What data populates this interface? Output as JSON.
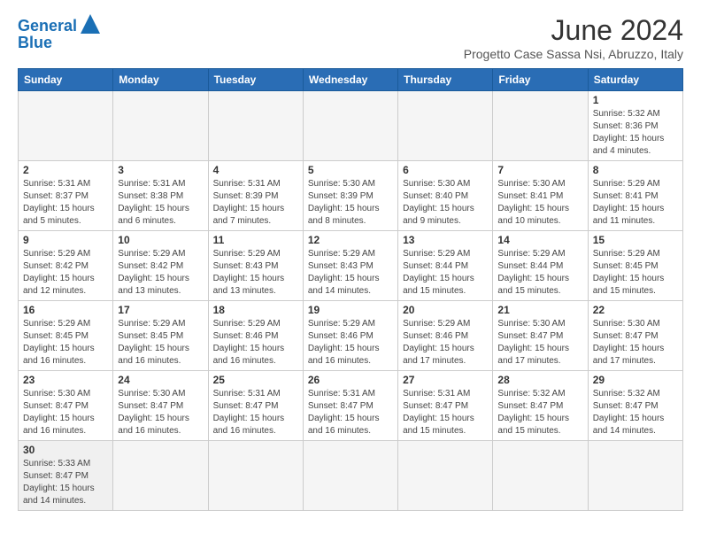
{
  "header": {
    "logo_general": "General",
    "logo_blue": "Blue",
    "title": "June 2024",
    "subtitle": "Progetto Case Sassa Nsi, Abruzzo, Italy"
  },
  "days_of_week": [
    "Sunday",
    "Monday",
    "Tuesday",
    "Wednesday",
    "Thursday",
    "Friday",
    "Saturday"
  ],
  "weeks": [
    [
      {
        "day": "",
        "info": ""
      },
      {
        "day": "",
        "info": ""
      },
      {
        "day": "",
        "info": ""
      },
      {
        "day": "",
        "info": ""
      },
      {
        "day": "",
        "info": ""
      },
      {
        "day": "",
        "info": ""
      },
      {
        "day": "1",
        "info": "Sunrise: 5:32 AM\nSunset: 8:36 PM\nDaylight: 15 hours\nand 4 minutes."
      }
    ],
    [
      {
        "day": "2",
        "info": "Sunrise: 5:31 AM\nSunset: 8:37 PM\nDaylight: 15 hours\nand 5 minutes."
      },
      {
        "day": "3",
        "info": "Sunrise: 5:31 AM\nSunset: 8:38 PM\nDaylight: 15 hours\nand 6 minutes."
      },
      {
        "day": "4",
        "info": "Sunrise: 5:31 AM\nSunset: 8:39 PM\nDaylight: 15 hours\nand 7 minutes."
      },
      {
        "day": "5",
        "info": "Sunrise: 5:30 AM\nSunset: 8:39 PM\nDaylight: 15 hours\nand 8 minutes."
      },
      {
        "day": "6",
        "info": "Sunrise: 5:30 AM\nSunset: 8:40 PM\nDaylight: 15 hours\nand 9 minutes."
      },
      {
        "day": "7",
        "info": "Sunrise: 5:30 AM\nSunset: 8:41 PM\nDaylight: 15 hours\nand 10 minutes."
      },
      {
        "day": "8",
        "info": "Sunrise: 5:29 AM\nSunset: 8:41 PM\nDaylight: 15 hours\nand 11 minutes."
      }
    ],
    [
      {
        "day": "9",
        "info": "Sunrise: 5:29 AM\nSunset: 8:42 PM\nDaylight: 15 hours\nand 12 minutes."
      },
      {
        "day": "10",
        "info": "Sunrise: 5:29 AM\nSunset: 8:42 PM\nDaylight: 15 hours\nand 13 minutes."
      },
      {
        "day": "11",
        "info": "Sunrise: 5:29 AM\nSunset: 8:43 PM\nDaylight: 15 hours\nand 13 minutes."
      },
      {
        "day": "12",
        "info": "Sunrise: 5:29 AM\nSunset: 8:43 PM\nDaylight: 15 hours\nand 14 minutes."
      },
      {
        "day": "13",
        "info": "Sunrise: 5:29 AM\nSunset: 8:44 PM\nDaylight: 15 hours\nand 15 minutes."
      },
      {
        "day": "14",
        "info": "Sunrise: 5:29 AM\nSunset: 8:44 PM\nDaylight: 15 hours\nand 15 minutes."
      },
      {
        "day": "15",
        "info": "Sunrise: 5:29 AM\nSunset: 8:45 PM\nDaylight: 15 hours\nand 15 minutes."
      }
    ],
    [
      {
        "day": "16",
        "info": "Sunrise: 5:29 AM\nSunset: 8:45 PM\nDaylight: 15 hours\nand 16 minutes."
      },
      {
        "day": "17",
        "info": "Sunrise: 5:29 AM\nSunset: 8:45 PM\nDaylight: 15 hours\nand 16 minutes."
      },
      {
        "day": "18",
        "info": "Sunrise: 5:29 AM\nSunset: 8:46 PM\nDaylight: 15 hours\nand 16 minutes."
      },
      {
        "day": "19",
        "info": "Sunrise: 5:29 AM\nSunset: 8:46 PM\nDaylight: 15 hours\nand 16 minutes."
      },
      {
        "day": "20",
        "info": "Sunrise: 5:29 AM\nSunset: 8:46 PM\nDaylight: 15 hours\nand 17 minutes."
      },
      {
        "day": "21",
        "info": "Sunrise: 5:30 AM\nSunset: 8:47 PM\nDaylight: 15 hours\nand 17 minutes."
      },
      {
        "day": "22",
        "info": "Sunrise: 5:30 AM\nSunset: 8:47 PM\nDaylight: 15 hours\nand 17 minutes."
      }
    ],
    [
      {
        "day": "23",
        "info": "Sunrise: 5:30 AM\nSunset: 8:47 PM\nDaylight: 15 hours\nand 16 minutes."
      },
      {
        "day": "24",
        "info": "Sunrise: 5:30 AM\nSunset: 8:47 PM\nDaylight: 15 hours\nand 16 minutes."
      },
      {
        "day": "25",
        "info": "Sunrise: 5:31 AM\nSunset: 8:47 PM\nDaylight: 15 hours\nand 16 minutes."
      },
      {
        "day": "26",
        "info": "Sunrise: 5:31 AM\nSunset: 8:47 PM\nDaylight: 15 hours\nand 16 minutes."
      },
      {
        "day": "27",
        "info": "Sunrise: 5:31 AM\nSunset: 8:47 PM\nDaylight: 15 hours\nand 15 minutes."
      },
      {
        "day": "28",
        "info": "Sunrise: 5:32 AM\nSunset: 8:47 PM\nDaylight: 15 hours\nand 15 minutes."
      },
      {
        "day": "29",
        "info": "Sunrise: 5:32 AM\nSunset: 8:47 PM\nDaylight: 15 hours\nand 14 minutes."
      }
    ],
    [
      {
        "day": "30",
        "info": "Sunrise: 5:33 AM\nSunset: 8:47 PM\nDaylight: 15 hours\nand 14 minutes."
      },
      {
        "day": "",
        "info": ""
      },
      {
        "day": "",
        "info": ""
      },
      {
        "day": "",
        "info": ""
      },
      {
        "day": "",
        "info": ""
      },
      {
        "day": "",
        "info": ""
      },
      {
        "day": "",
        "info": ""
      }
    ]
  ]
}
